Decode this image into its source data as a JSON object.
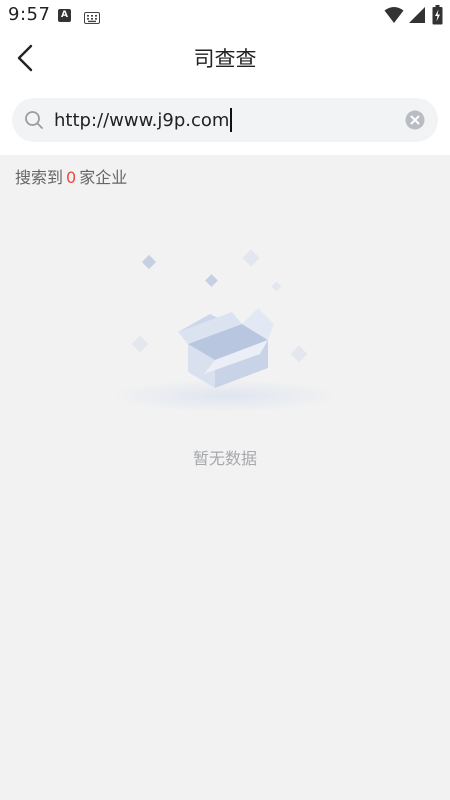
{
  "status_bar": {
    "time": "9:57",
    "icons": [
      "a-notification-icon",
      "keyboard-icon",
      "wifi-icon",
      "signal-icon",
      "battery-charging-icon"
    ]
  },
  "header": {
    "title": "司查查",
    "back_icon": "chevron-left-icon"
  },
  "search": {
    "value": "http://www.j9p.com",
    "icon": "search-icon",
    "clear_icon": "clear-icon"
  },
  "results": {
    "prefix": "搜索到",
    "count": "0",
    "suffix": "家企业"
  },
  "empty_state": {
    "message": "暂无数据",
    "icon": "empty-box-icon"
  },
  "colors": {
    "accent_count": "#e84c3d",
    "background": "#f2f2f2",
    "search_bg": "#f2f3f5",
    "empty_text": "#a6a8ad"
  }
}
